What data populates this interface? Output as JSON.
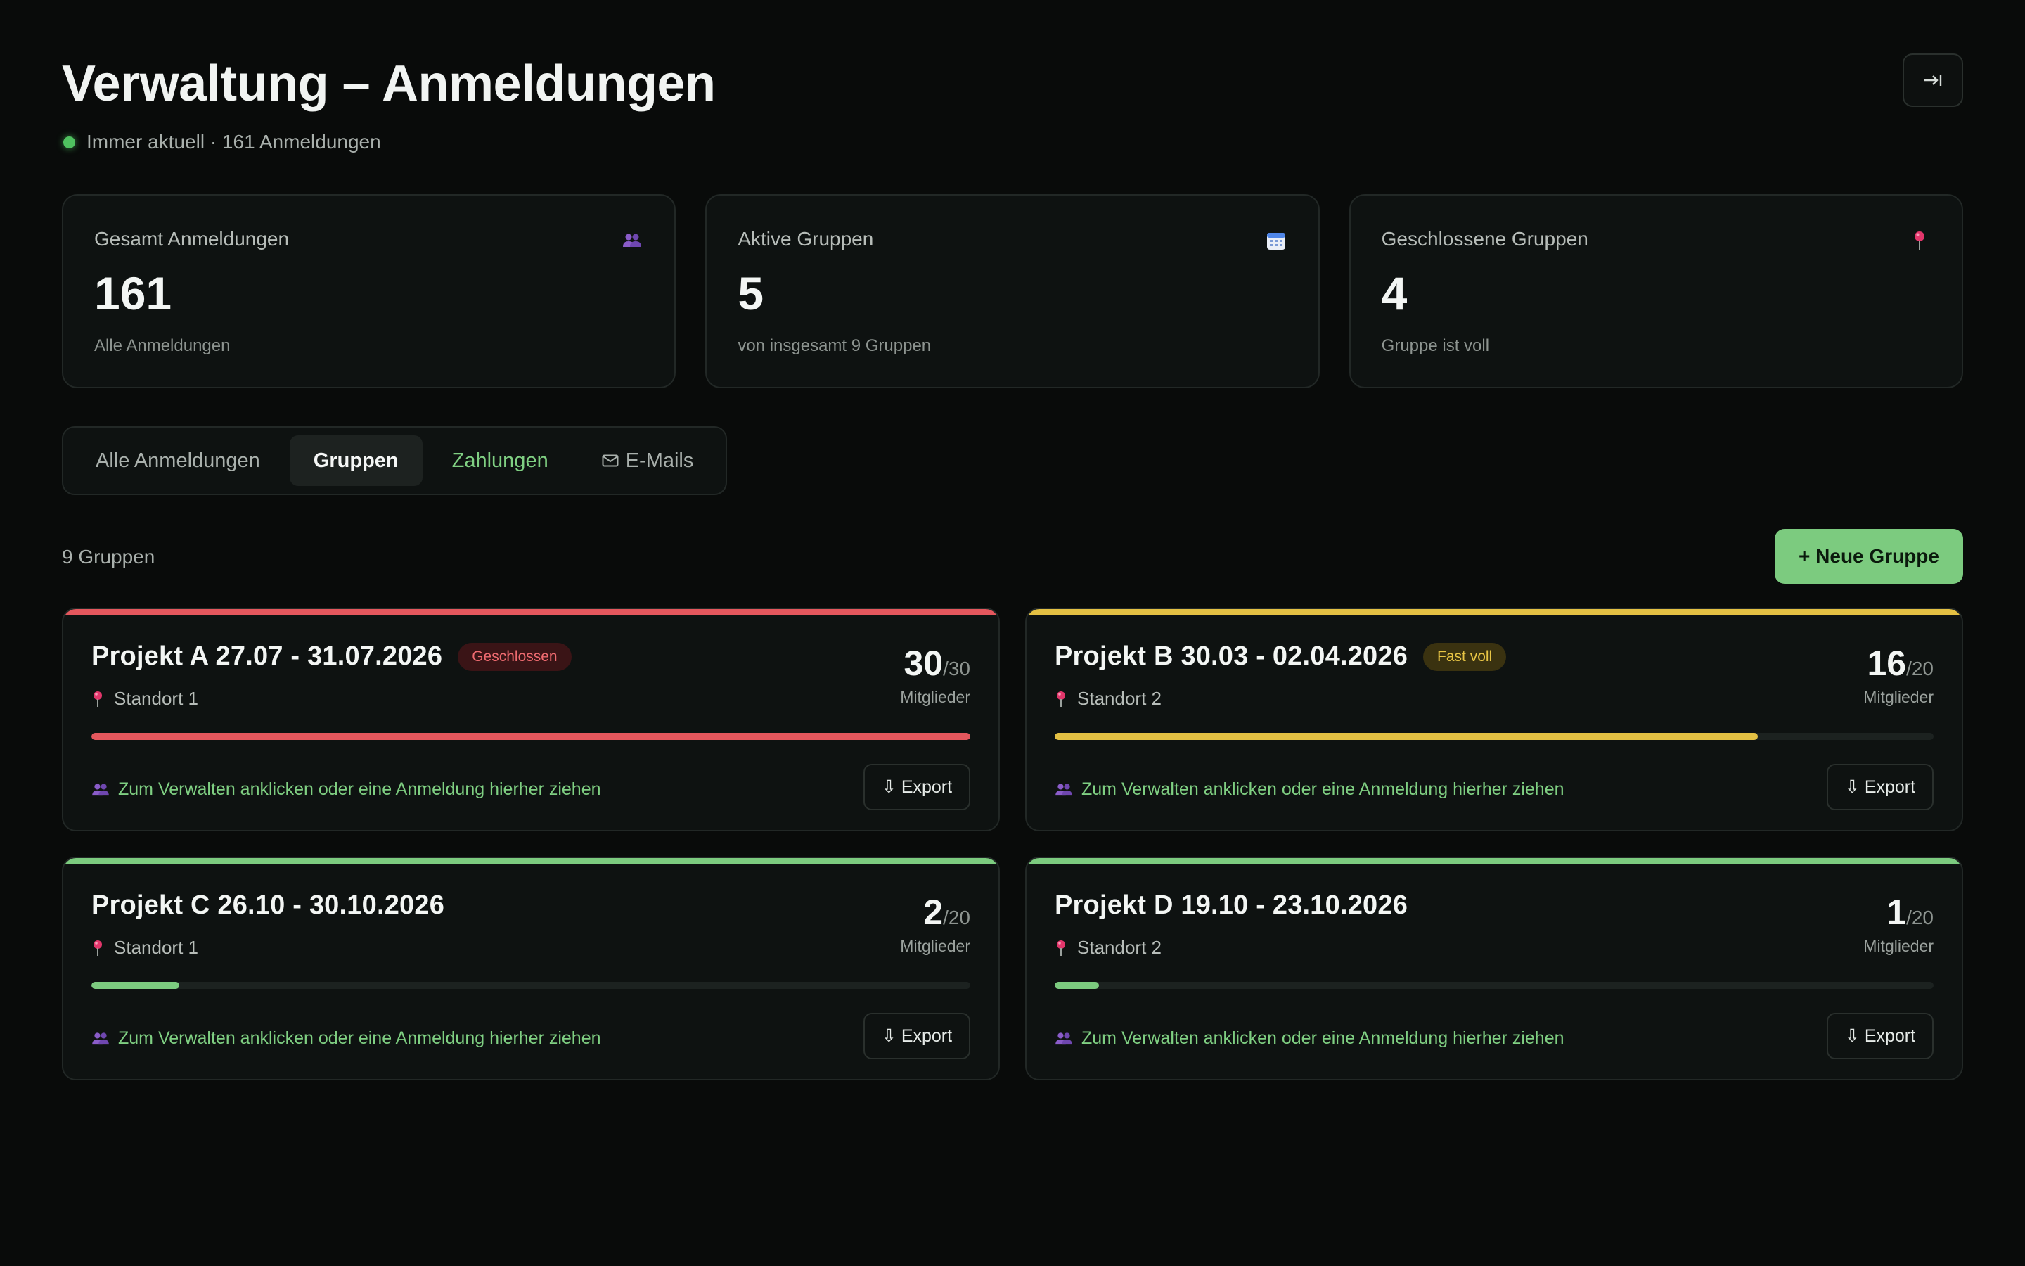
{
  "header": {
    "title": "Verwaltung – Anmeldungen",
    "status_text": "Immer aktuell · 161 Anmeldungen",
    "logout_icon": "logout-arrow-icon"
  },
  "stats": [
    {
      "label": "Gesamt Anmeldungen",
      "value": "161",
      "sub": "Alle Anmeldungen",
      "icon": "people-icon"
    },
    {
      "label": "Aktive Gruppen",
      "value": "5",
      "sub": "von insgesamt 9 Gruppen",
      "icon": "calendar-icon"
    },
    {
      "label": "Geschlossene Gruppen",
      "value": "4",
      "sub": "Gruppe ist voll",
      "icon": "pin-icon"
    }
  ],
  "tabs": [
    {
      "label": "Alle Anmeldungen",
      "active": false
    },
    {
      "label": "Gruppen",
      "active": true
    },
    {
      "label": "Zahlungen",
      "active": false
    },
    {
      "label": "E-Mails",
      "active": false,
      "icon": "mail-icon"
    }
  ],
  "groups_toolbar": {
    "count_text": "9 Gruppen",
    "new_group_label": "+ Neue Gruppe"
  },
  "colors": {
    "red": "#e4575d",
    "yellow": "#e3c043",
    "green": "#7ccb7f",
    "accent_green": "#7fcf82"
  },
  "groups": [
    {
      "title": "Projekt A 27.07 - 31.07.2026",
      "badge": "Geschlossen",
      "location": "Standort 1",
      "count": "30",
      "max": "/30",
      "count_label": "Mitglieder",
      "fill_fraction": 1.0,
      "status_color": "#e4575d",
      "hint": "Zum Verwalten anklicken oder eine Anmeldung hierher ziehen",
      "export_label": "⇩ Export"
    },
    {
      "title": "Projekt B 30.03 - 02.04.2026",
      "badge": "Fast voll",
      "location": "Standort 2",
      "count": "16",
      "max": "/20",
      "count_label": "Mitglieder",
      "fill_fraction": 0.8,
      "status_color": "#e3c043",
      "hint": "Zum Verwalten anklicken oder eine Anmeldung hierher ziehen",
      "export_label": "⇩ Export"
    },
    {
      "title": "Projekt C 26.10 - 30.10.2026",
      "badge": "",
      "location": "Standort 1",
      "count": "2",
      "max": "/20",
      "count_label": "Mitglieder",
      "fill_fraction": 0.1,
      "status_color": "#7ccb7f",
      "hint": "Zum Verwalten anklicken oder eine Anmeldung hierher ziehen",
      "export_label": "⇩ Export"
    },
    {
      "title": "Projekt D 19.10 - 23.10.2026",
      "badge": "",
      "location": "Standort 2",
      "count": "1",
      "max": "/20",
      "count_label": "Mitglieder",
      "fill_fraction": 0.05,
      "status_color": "#7ccb7f",
      "hint": "Zum Verwalten anklicken oder eine Anmeldung hierher ziehen",
      "export_label": "⇩ Export"
    }
  ]
}
